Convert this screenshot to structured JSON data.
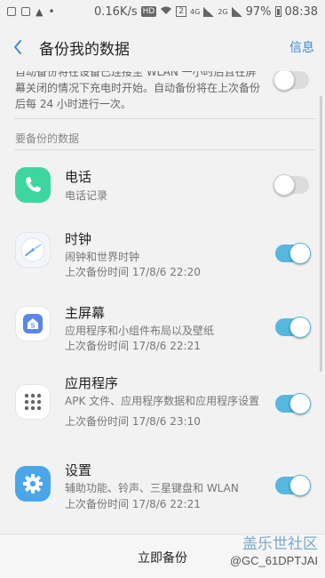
{
  "status_bar": {
    "speed": "0.16K/s",
    "hd": "HD",
    "sim_slot": "2",
    "net_4g": "4G",
    "net_2g": "2G",
    "battery": "97%",
    "time": "08:38"
  },
  "header": {
    "title": "备份我的数据",
    "info_link": "信息"
  },
  "auto_backup": {
    "description": "自动备份将在设备已连接至 WLAN 一小时后且在屏幕关闭的情况下充电时开始。自动备份将在上次备份后每 24 小时进行一次。",
    "enabled": false
  },
  "section": {
    "header": "要备份的数据"
  },
  "items": [
    {
      "title": "电话",
      "line1": "电话记录",
      "line2": "",
      "enabled": false,
      "icon": "phone-icon",
      "color": "#3dd6a0"
    },
    {
      "title": "时钟",
      "line1": "闹钟和世界时钟",
      "line2": "上次备份时间 17/8/6 22:20",
      "enabled": true,
      "icon": "clock-icon",
      "color": "#f2f6fb"
    },
    {
      "title": "主屏幕",
      "line1": "应用程序和小组件布局以及壁纸",
      "line2": "上次备份时间 17/8/6 22:21",
      "enabled": true,
      "icon": "home-icon",
      "color": "#ffffff"
    },
    {
      "title": "应用程序",
      "line1": "APK 文件、应用程序数据和应用程序设置",
      "line2": "上次备份时间 17/8/6 23:10",
      "enabled": true,
      "icon": "apps-grid-icon",
      "color": "#ffffff"
    },
    {
      "title": "设置",
      "line1": "辅助功能、铃声、三星键盘和 WLAN",
      "line2": "上次备份时间 17/8/6 22:21",
      "enabled": true,
      "icon": "settings-gear-icon",
      "color": "#4aa6e8"
    }
  ],
  "bottom": {
    "backup_now": "立即备份",
    "watermark_logo": "盖乐世社区",
    "watermark_user": "@GC_61DPTJAI"
  },
  "colors": {
    "accent": "#56b8df",
    "link": "#3d8bd1"
  }
}
